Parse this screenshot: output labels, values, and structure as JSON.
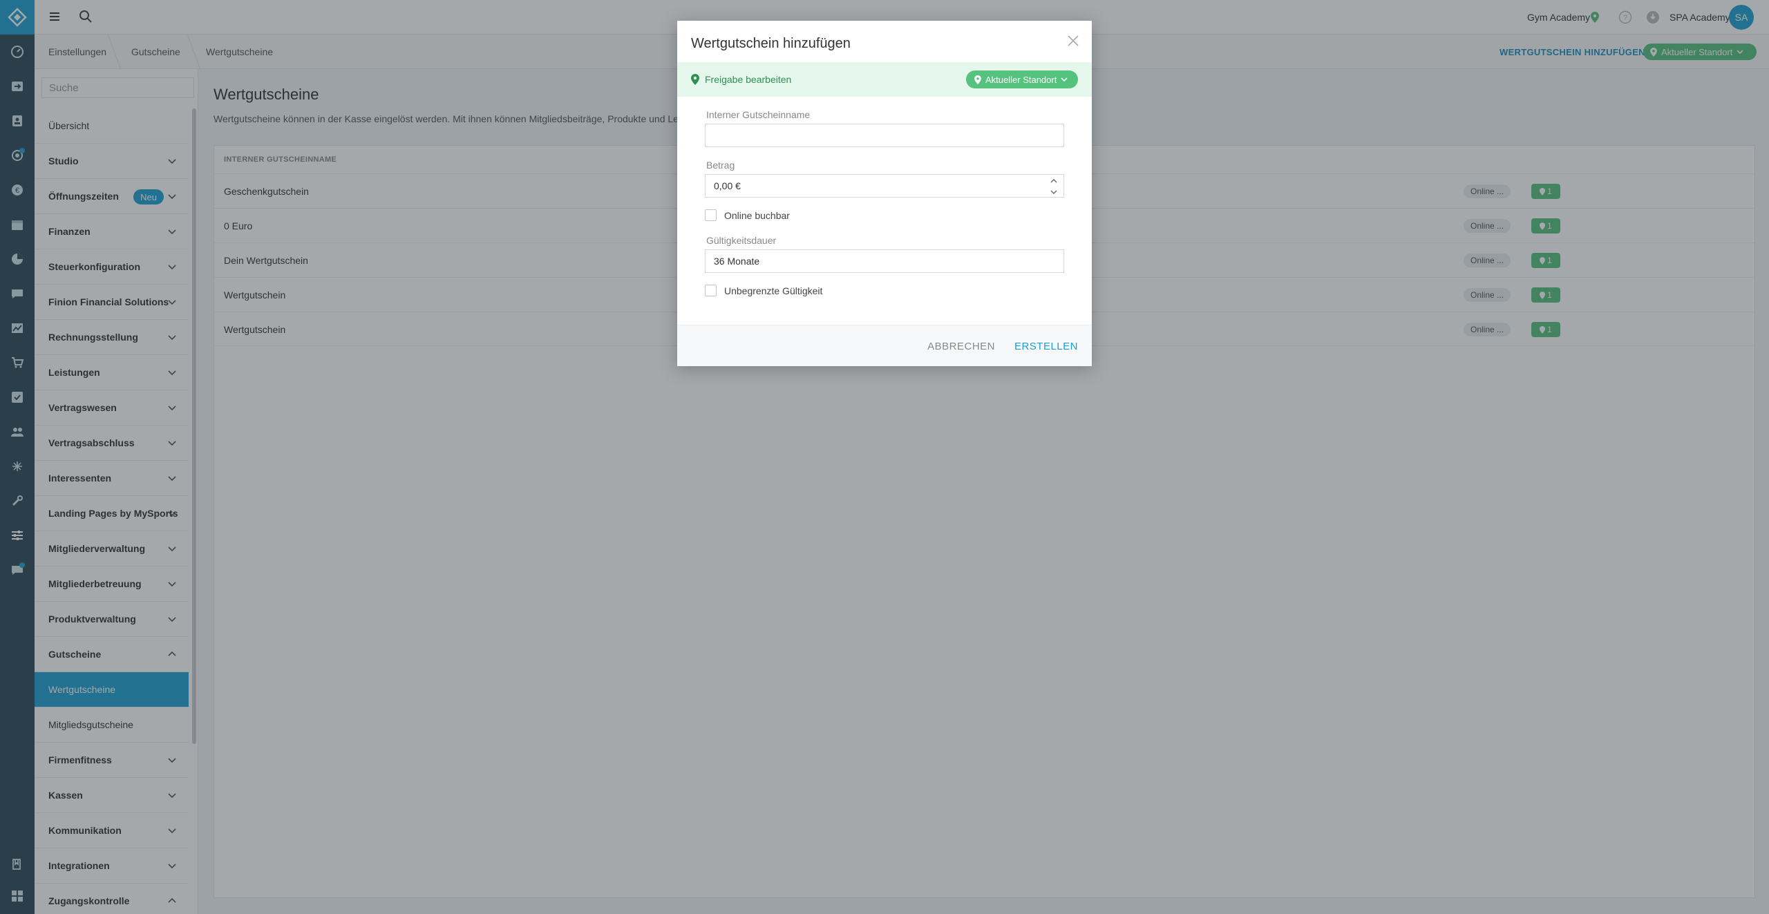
{
  "header": {
    "studio_name": "Gym Academy",
    "user_name": "SPA Academy",
    "user_initials": "SA"
  },
  "breadcrumb": [
    "Einstellungen",
    "Gutscheine",
    "Wertgutscheine"
  ],
  "subbar": {
    "add_label": "WERTGUTSCHEIN HINZUFÜGEN",
    "location_label": "Aktueller Standort"
  },
  "sidebar": {
    "search_placeholder": "Suche",
    "items": [
      {
        "label": "Übersicht"
      },
      {
        "label": "Studio"
      },
      {
        "label": "Öffnungszeiten",
        "badge": "Neu"
      },
      {
        "label": "Finanzen"
      },
      {
        "label": "Steuerkonfiguration"
      },
      {
        "label": "Finion Financial Solutions"
      },
      {
        "label": "Rechnungsstellung"
      },
      {
        "label": "Leistungen"
      },
      {
        "label": "Vertragswesen"
      },
      {
        "label": "Vertragsabschluss"
      },
      {
        "label": "Interessenten"
      },
      {
        "label": "Landing Pages by MySports"
      },
      {
        "label": "Mitgliederverwaltung"
      },
      {
        "label": "Mitgliederbetreuung"
      },
      {
        "label": "Produktverwaltung"
      },
      {
        "label": "Gutscheine"
      },
      {
        "label": "Wertgutscheine"
      },
      {
        "label": "Mitgliedsgutscheine"
      },
      {
        "label": "Firmenfitness"
      },
      {
        "label": "Kassen"
      },
      {
        "label": "Kommunikation"
      },
      {
        "label": "Integrationen"
      },
      {
        "label": "Zugangskontrolle"
      }
    ]
  },
  "main": {
    "title": "Wertgutscheine",
    "description": "Wertgutscheine können in der Kasse eingelöst werden. Mit ihnen können Mitgliedsbeiträge, Produkte und Leistungen",
    "column_header": "INTERNER GUTSCHEINNAME",
    "rows": [
      {
        "name": "Geschenkgutschein",
        "online": "Online ...",
        "locations": "1"
      },
      {
        "name": "0 Euro",
        "online": "Online ...",
        "locations": "1"
      },
      {
        "name": "Dein Wertgutschein",
        "online": "Online ...",
        "locations": "1"
      },
      {
        "name": "Wertgutschein",
        "online": "Online ...",
        "locations": "1"
      },
      {
        "name": "Wertgutschein",
        "online": "Online ...",
        "locations": "1"
      }
    ]
  },
  "modal": {
    "title": "Wertgutschein hinzufügen",
    "share_label": "Freigabe bearbeiten",
    "share_location": "Aktueller Standort",
    "name_label": "Interner Gutscheinname",
    "name_value": "",
    "amount_label": "Betrag",
    "amount_value": "0,00 €",
    "online_label": "Online buchbar",
    "validity_label": "Gültigkeitsdauer",
    "validity_value": "36 Monate",
    "unlimited_label": "Unbegrenzte Gültigkeit",
    "cancel_label": "ABBRECHEN",
    "create_label": "ERSTELLEN"
  },
  "colors": {
    "accent": "#20a1d3",
    "rail": "#2b4a57",
    "success": "#55c27d"
  }
}
